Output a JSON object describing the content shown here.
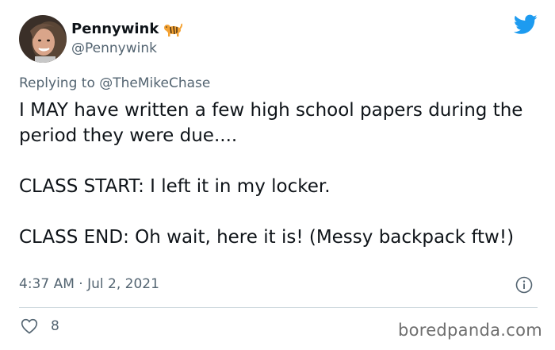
{
  "author": {
    "display_name": "Pennywink",
    "handle": "@Pennywink",
    "avatar_icon": "profile-photo",
    "badge_emoji": "tiger-emoji"
  },
  "reply": {
    "prefix": "Replying to ",
    "mention": "@TheMikeChase"
  },
  "tweet": {
    "text": "I MAY have written a few high school papers during the period they were due....\n\nCLASS START: I left it in my locker.\n\nCLASS END: Oh wait, here it is! (Messy backpack ftw!)"
  },
  "meta": {
    "timestamp": "4:37 AM · Jul 2, 2021"
  },
  "engagement": {
    "likes": "8"
  },
  "watermark": "boredpanda.com",
  "colors": {
    "twitter_blue": "#1d9bf0",
    "secondary_text": "#536471",
    "divider": "#cfd9de"
  }
}
